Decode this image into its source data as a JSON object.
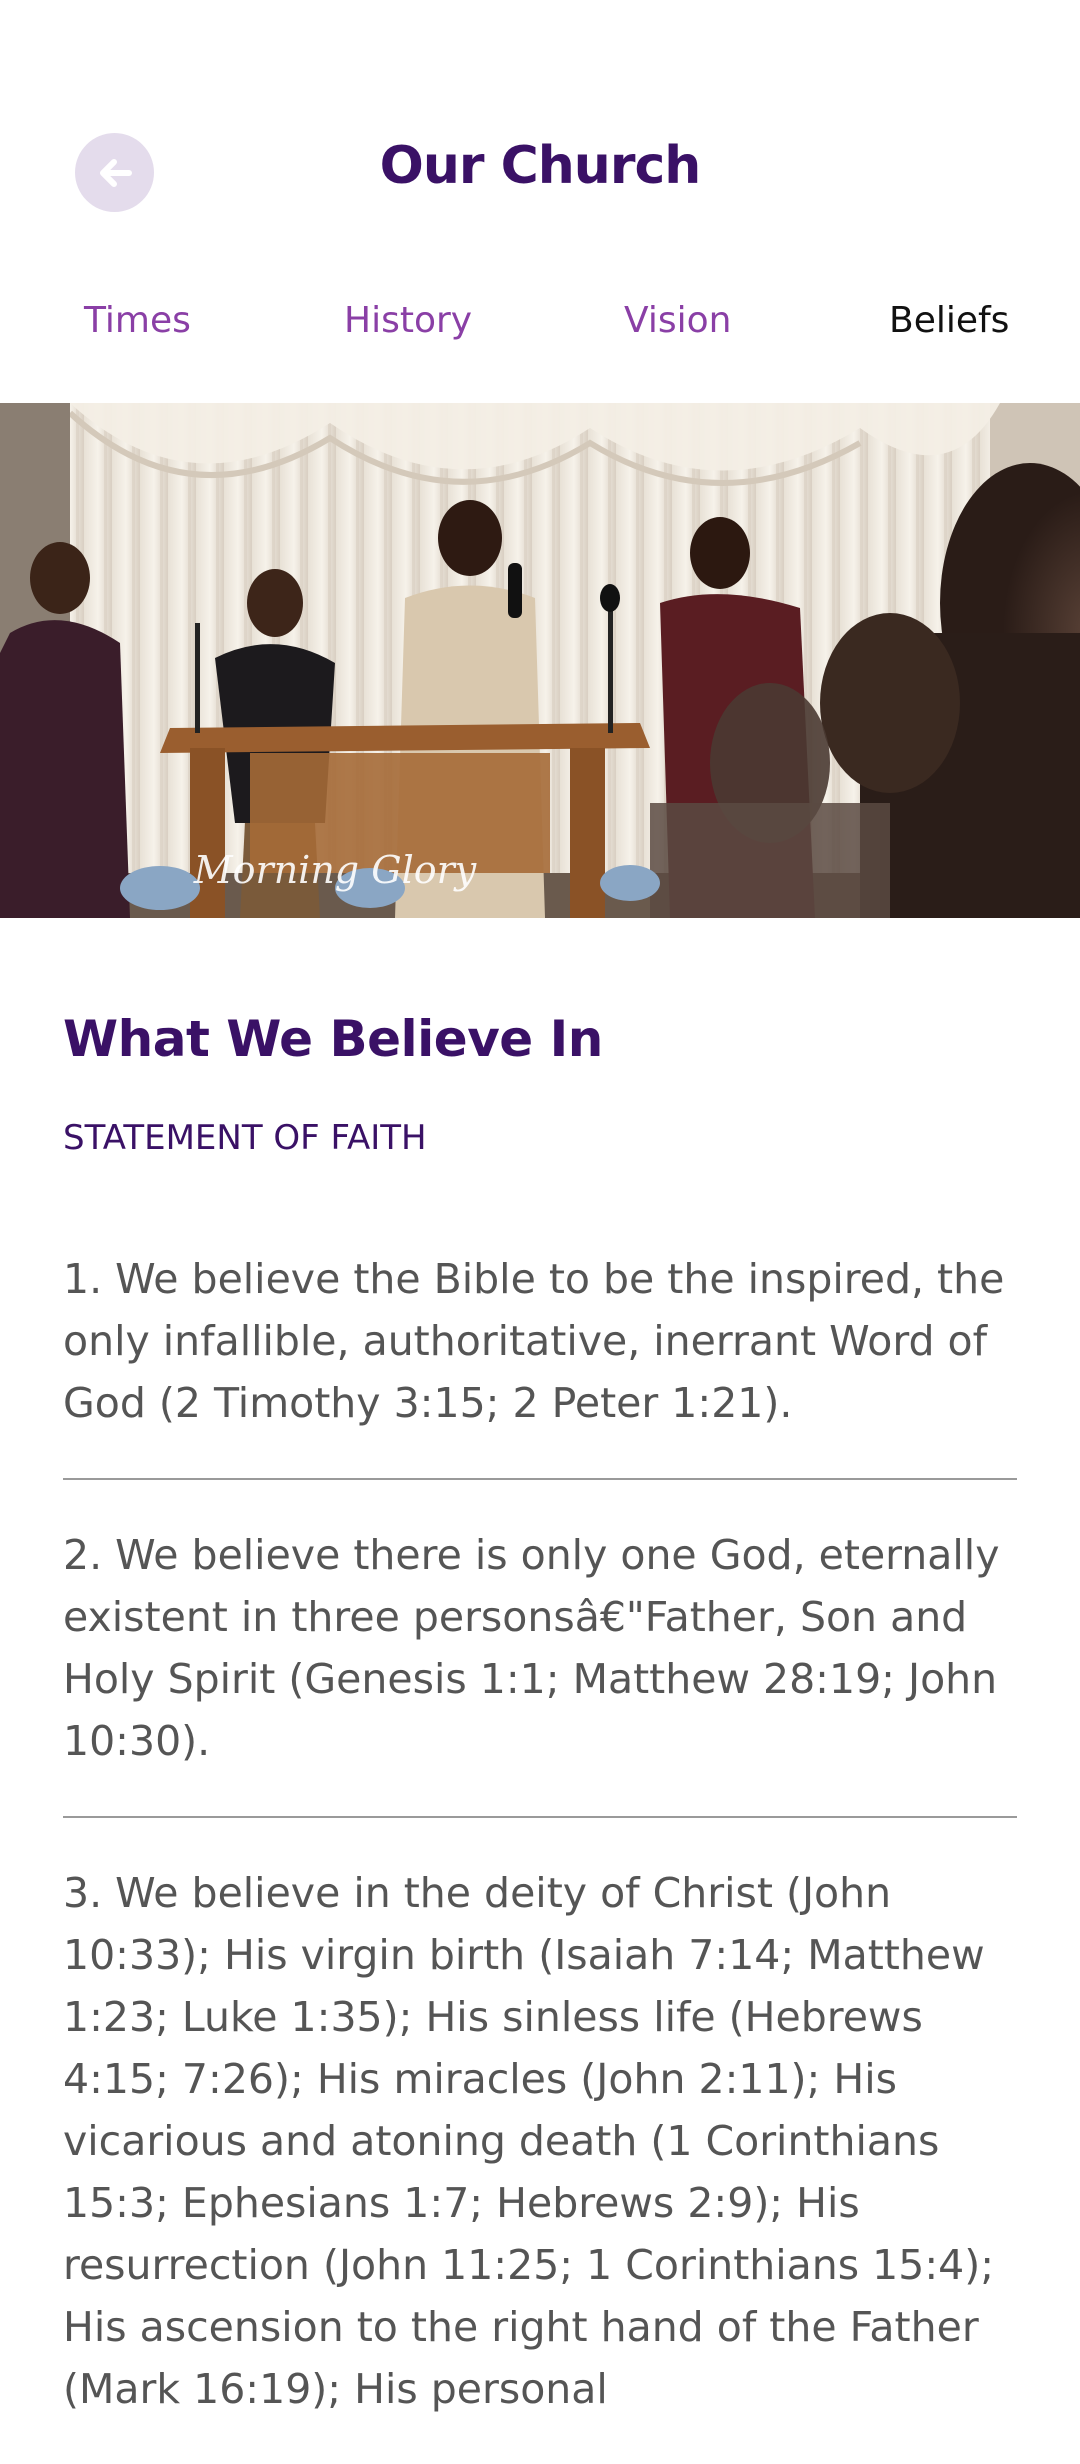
{
  "header": {
    "title": "Our Church",
    "back_icon": "arrow-left-icon"
  },
  "tabs": [
    {
      "label": "Times",
      "active": false
    },
    {
      "label": "History",
      "active": false
    },
    {
      "label": "Vision",
      "active": false
    },
    {
      "label": "Beliefs",
      "active": true
    }
  ],
  "hero": {
    "watermark": "Morning Glory"
  },
  "main": {
    "heading": "What We Believe In",
    "subheading": "STATEMENT OF FAITH",
    "beliefs": [
      "1. We believe the Bible to be the inspired, the only infallible, authoritative, inerrant Word of God (2 Timothy 3:15; 2 Peter 1:21).",
      "2. We believe there is only one God, eternally existent in three personsâ€\"Father, Son and Holy Spirit (Genesis 1:1; Matthew 28:19; John 10:30).",
      "3. We believe in the deity of Christ (John 10:33); His virgin birth (Isaiah 7:14; Matthew 1:23; Luke 1:35); His sinless life (Hebrews 4:15; 7:26); His miracles (John 2:11); His vicarious and atoning death (1 Corinthians 15:3; Ephesians 1:7; Hebrews 2:9); His resurrection (John 11:25; 1 Corinthians 15:4); His ascension to the right hand of the Father (Mark 16:19); His personal"
    ]
  },
  "colors": {
    "brand_purple": "#3a1166",
    "tab_purple": "#8a3fa6",
    "back_button_bg": "#e4dcec",
    "body_text": "#555555"
  }
}
